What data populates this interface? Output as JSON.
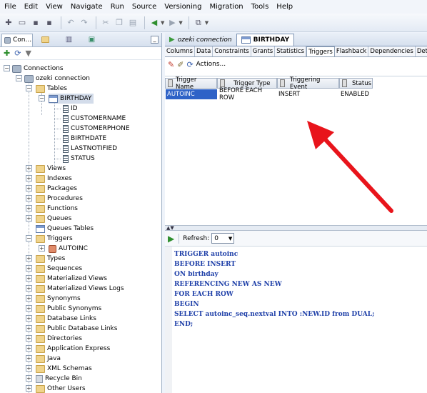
{
  "menubar": {
    "items": [
      "File",
      "Edit",
      "View",
      "Navigate",
      "Run",
      "Source",
      "Versioning",
      "Migration",
      "Tools",
      "Help"
    ]
  },
  "left_panel": {
    "tab_label": "Con...",
    "tree": {
      "root": "Connections",
      "connection": "ozeki connection",
      "tables_folder": "Tables",
      "table": "BIRTHDAY",
      "columns": [
        "ID",
        "CUSTOMERNAME",
        "CUSTOMERPHONE",
        "BIRTHDATE",
        "LASTNOTIFIED",
        "STATUS"
      ],
      "folders_before_triggers": [
        "Views",
        "Indexes",
        "Packages",
        "Procedures",
        "Functions",
        "Queues",
        "Queues Tables"
      ],
      "triggers_folder": "Triggers",
      "trigger_item": "AUTOINC",
      "folders_after_triggers": [
        "Types",
        "Sequences",
        "Materialized Views",
        "Materialized Views Logs",
        "Synonyms",
        "Public Synonyms",
        "Database Links",
        "Public Database Links",
        "Directories",
        "Application Express",
        "Java",
        "XML Schemas",
        "Recycle Bin",
        "Other Users"
      ]
    }
  },
  "editor": {
    "doc_tabs": [
      "ozeki connection",
      "BIRTHDAY"
    ],
    "sub_tabs": [
      "Columns",
      "Data",
      "Constraints",
      "Grants",
      "Statistics",
      "Triggers",
      "Flashback",
      "Dependencies",
      "Details",
      "I"
    ],
    "active_sub_tab": "Triggers",
    "actions_label": "Actions...",
    "grid": {
      "headers": [
        "Trigger Name",
        "Trigger Type",
        "Triggering Event",
        "Status"
      ],
      "rows": [
        [
          "AUTOINC",
          "BEFORE EACH ROW",
          "INSERT",
          "ENABLED"
        ]
      ]
    },
    "refresh_label": "Refresh:",
    "refresh_value": "0",
    "code_lines": [
      "TRIGGER autoinc",
      "BEFORE INSERT",
      "ON birthday",
      "REFERENCING NEW AS NEW",
      "FOR EACH ROW",
      "BEGIN",
      "SELECT autoinc_seq.nextval INTO :NEW.ID from DUAL;",
      "END;"
    ]
  },
  "annotation": {
    "arrow_color": "#e8141b"
  }
}
